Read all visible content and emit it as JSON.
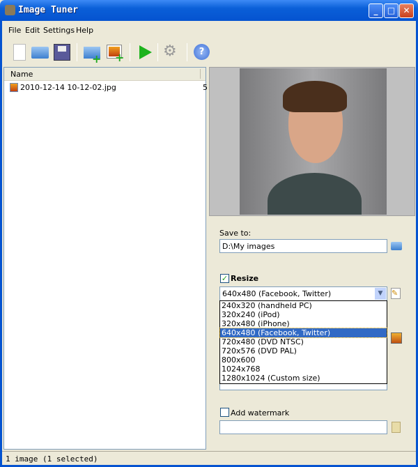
{
  "window": {
    "title": "Image Tuner",
    "buttons": [
      "minimize",
      "maximize",
      "close"
    ]
  },
  "menu": [
    "File",
    "Edit",
    "Settings",
    "Help"
  ],
  "toolbar": [
    "new-icon",
    "open-folder-icon",
    "save-icon",
    "add-folder-icon",
    "add-image-icon",
    "run-icon",
    "settings-icon",
    "help-icon"
  ],
  "file_list": {
    "column": "Name",
    "rows": [
      {
        "name": "2010-12-14 10-12-02.jpg",
        "extra": "5"
      }
    ]
  },
  "save_to": {
    "label": "Save to:",
    "value": "D:\\My images"
  },
  "resize": {
    "label": "Resize",
    "checked": true,
    "selected": "640x480 (Facebook, Twitter)",
    "options": [
      "240x320 (handheld PC)",
      "320x240 (iPod)",
      "320x480 (iPhone)",
      "640x480 (Facebook, Twitter)",
      "720x480 (DVD NTSC)",
      "720x576 (DVD PAL)",
      "800x600",
      "1024x768",
      "1280x1024 (Custom size)"
    ],
    "selected_index": 3
  },
  "watermark": {
    "label": "Add watermark",
    "checked": false,
    "value": ""
  },
  "status": "1 image (1 selected)"
}
